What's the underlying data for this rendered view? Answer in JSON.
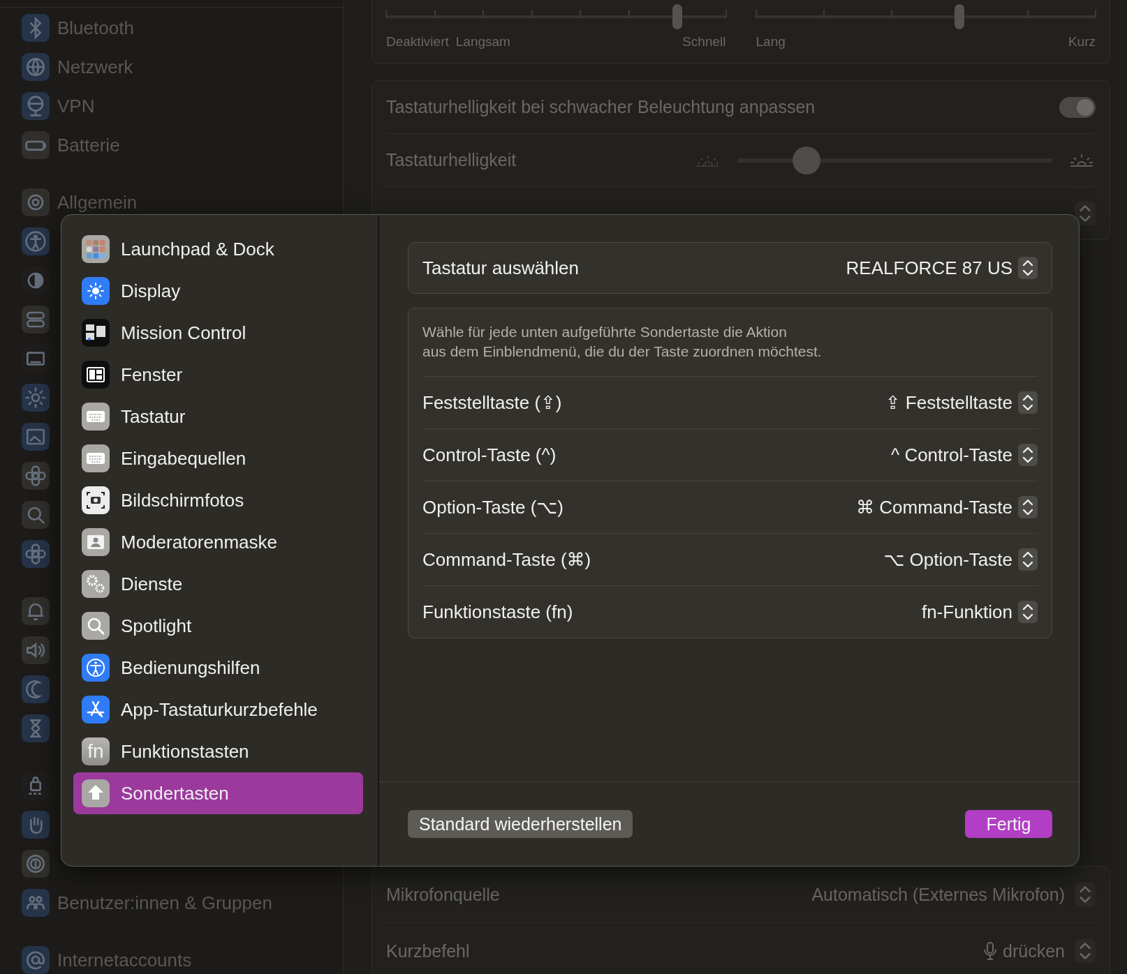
{
  "sidebar": {
    "items": [
      {
        "label": "Bluetooth"
      },
      {
        "label": "Netzwerk"
      },
      {
        "label": "VPN"
      },
      {
        "label": "Batterie"
      },
      {
        "label": "Allgemein"
      },
      {
        "label": "Benutzer:innen & Gruppen"
      },
      {
        "label": "Internetaccounts"
      }
    ]
  },
  "repeat_card": {
    "sliders": [
      {
        "level": 0.857,
        "labels": [
          "Deaktiviert",
          "Langsam",
          "Schnell"
        ]
      },
      {
        "level": 0.6,
        "labels": [
          "Lang",
          "Kurz"
        ]
      }
    ]
  },
  "backlight_card": {
    "rows": [
      {
        "kind": "toggle",
        "label": "Tastaturhelligkeit bei schwacher Beleuchtung anpassen",
        "on": true
      },
      {
        "kind": "slider",
        "label": "Tastaturhelligkeit",
        "level": 0.22
      },
      {
        "kind": "popup"
      }
    ]
  },
  "dictation_card": {
    "rows": [
      {
        "label": "Mikrofonquelle",
        "value": "Automatisch (Externes Mikrofon)"
      },
      {
        "label": "Kurzbefehl",
        "value": "drücken"
      }
    ]
  },
  "dialog": {
    "sidebar": [
      {
        "label": "Launchpad & Dock",
        "selected": false
      },
      {
        "label": "Display",
        "selected": false
      },
      {
        "label": "Mission Control",
        "selected": false
      },
      {
        "label": "Fenster",
        "selected": false
      },
      {
        "label": "Tastatur",
        "selected": false
      },
      {
        "label": "Eingabequellen",
        "selected": false
      },
      {
        "label": "Bildschirmfotos",
        "selected": false
      },
      {
        "label": "Moderatorenmaske",
        "selected": false
      },
      {
        "label": "Dienste",
        "selected": false
      },
      {
        "label": "Spotlight",
        "selected": false
      },
      {
        "label": "Bedienungshilfen",
        "selected": false
      },
      {
        "label": "App-Tastaturkurzbefehle",
        "selected": false
      },
      {
        "label": "Funktionstasten",
        "icon_text": "fn",
        "selected": false
      },
      {
        "label": "Sondertasten",
        "selected": true
      }
    ],
    "keyboard_select": {
      "label": "Tastatur auswählen",
      "value": "REALFORCE 87 US"
    },
    "description": "Wähle für jede unten aufgeführte Sondertaste die Aktion\naus dem Einblendmenü, die du der Taste zuordnen möchtest.",
    "keys": [
      {
        "label": "Feststelltaste (⇪)",
        "value": "⇪ Feststelltaste"
      },
      {
        "label": "Control-Taste (^)",
        "value": "^ Control-Taste"
      },
      {
        "label": "Option-Taste (⌥)",
        "value": "⌘ Command-Taste"
      },
      {
        "label": "Command-Taste (⌘)",
        "value": "⌥ Option-Taste"
      },
      {
        "label": "Funktionstaste (fn)",
        "value": "fn-Funktion"
      }
    ],
    "buttons": {
      "reset": "Standard wiederherstellen",
      "done": "Fertig"
    }
  }
}
